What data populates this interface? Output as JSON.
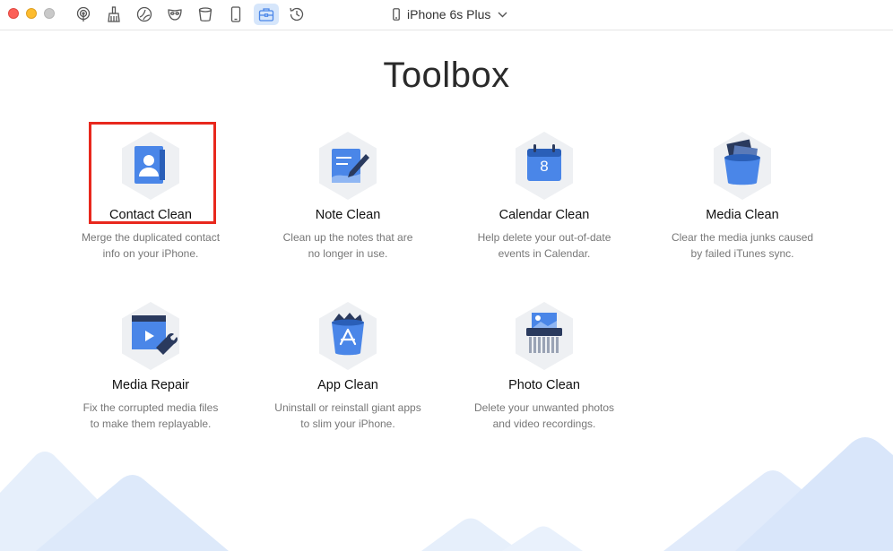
{
  "window": {
    "device_name": "iPhone 6s Plus"
  },
  "toolbar": {
    "icons": [
      "podcast-icon",
      "broom-icon",
      "cleaner-icon",
      "mask-icon",
      "trash-icon",
      "phone-icon",
      "toolbox-icon",
      "history-icon"
    ],
    "active": "toolbox-icon"
  },
  "main": {
    "title": "Toolbox",
    "tools": [
      {
        "name": "Contact Clean",
        "desc_line1": "Merge the duplicated contact",
        "desc_line2": "info on your iPhone.",
        "selected": true
      },
      {
        "name": "Note Clean",
        "desc_line1": "Clean up the notes that are",
        "desc_line2": "no longer in use."
      },
      {
        "name": "Calendar Clean",
        "desc_line1": "Help delete your out-of-date",
        "desc_line2": "events in Calendar.",
        "calendar_day": "8"
      },
      {
        "name": "Media Clean",
        "desc_line1": "Clear the media junks caused",
        "desc_line2": "by failed iTunes sync."
      },
      {
        "name": "Media Repair",
        "desc_line1": "Fix the corrupted media files",
        "desc_line2": "to make them replayable."
      },
      {
        "name": "App Clean",
        "desc_line1": "Uninstall or reinstall giant apps",
        "desc_line2": "to slim your iPhone."
      },
      {
        "name": "Photo Clean",
        "desc_line1": "Delete your unwanted photos",
        "desc_line2": "and video recordings."
      }
    ]
  },
  "colors": {
    "accent": "#4a86e8",
    "highlight": "#e8281d",
    "hex_bg": "#eef0f3"
  }
}
